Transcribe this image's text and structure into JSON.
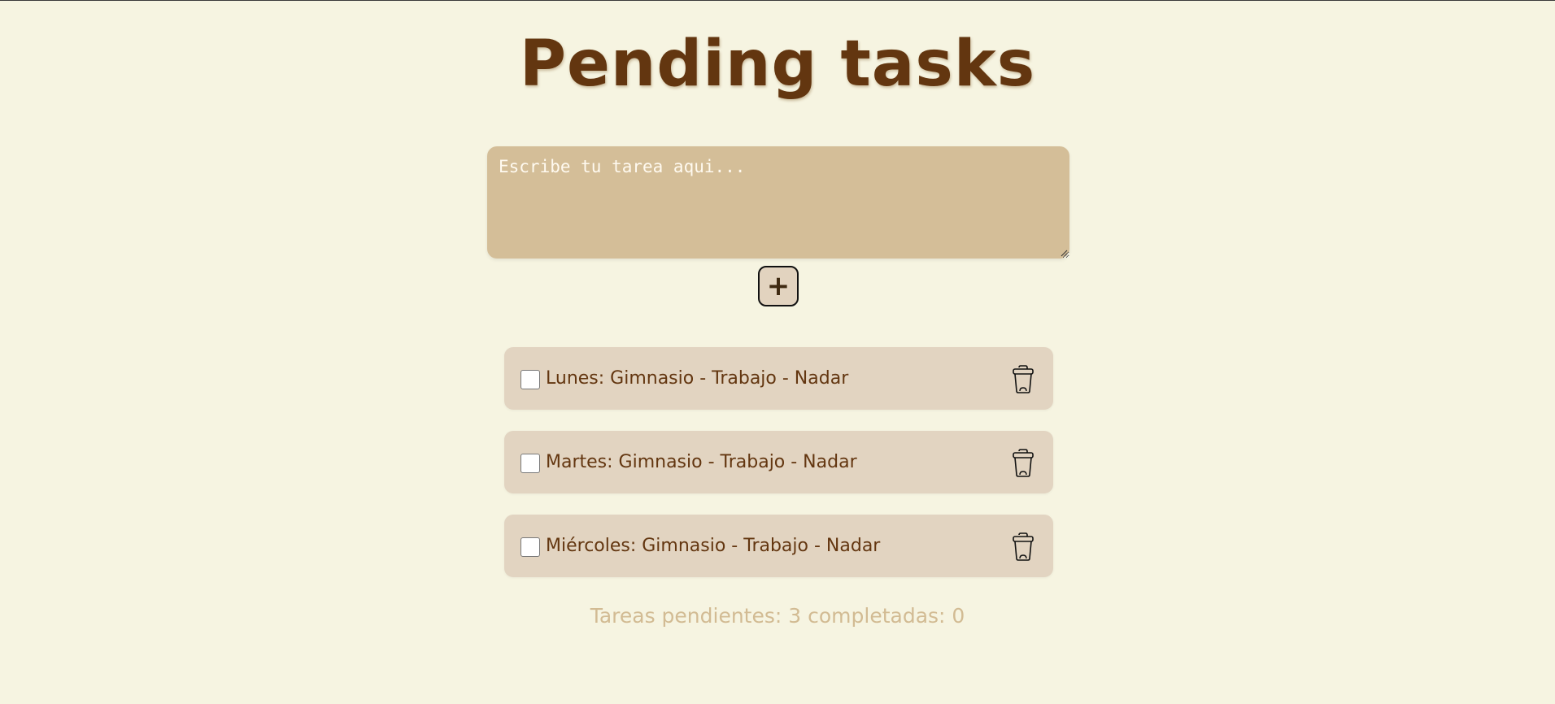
{
  "header": {
    "title": "Pending tasks"
  },
  "composer": {
    "placeholder": "Escribe tu tarea aqui...",
    "value": "",
    "add_label": "+"
  },
  "tasks": [
    {
      "text": "Lunes: Gimnasio - Trabajo - Nadar",
      "completed": false,
      "delete_icon": "trash-icon"
    },
    {
      "text": "Martes: Gimnasio - Trabajo - Nadar",
      "completed": false,
      "delete_icon": "trash-icon"
    },
    {
      "text": "Miércoles: Gimnasio - Trabajo - Nadar",
      "completed": false,
      "delete_icon": "trash-icon"
    }
  ],
  "footer": {
    "status": "Tareas pendientes: 3 completadas: 0"
  },
  "colors": {
    "background": "#f6f4e1",
    "title": "#633610",
    "input_bg": "#d4be98",
    "task_bg": "#e2d4c1",
    "status_text": "#d2bb93"
  }
}
